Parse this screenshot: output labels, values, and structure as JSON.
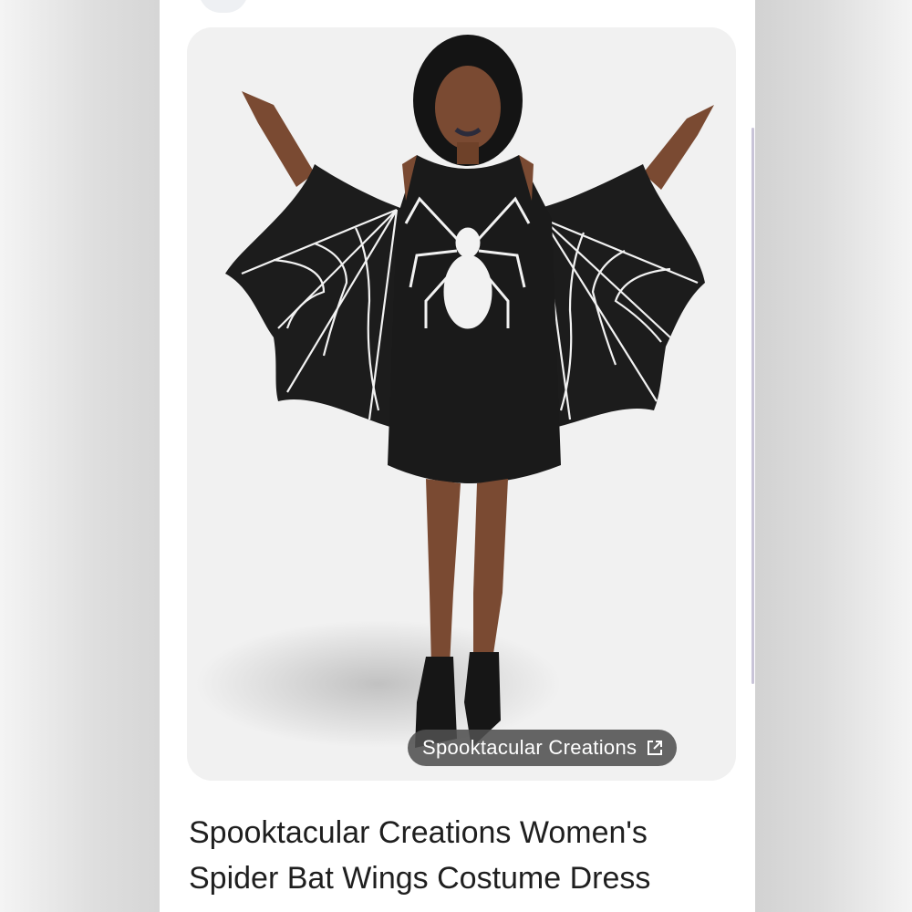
{
  "result": {
    "image": {
      "alt": "Woman wearing a black spider bat wings costume dress with white spider web print"
    },
    "source_chip": {
      "label": "Spooktacular Creations",
      "icon": "open-in-new-icon"
    },
    "title_line1": "Spooktacular Creations Women's",
    "title_line2": "Spider Bat Wings Costume Dress"
  },
  "colors": {
    "panel_bg": "#ffffff",
    "card_bg": "#f1f1f1",
    "chip_bg": "#505050",
    "title_text": "#1f1f1f",
    "garment": "#1c1c1c",
    "web_print": "#f2f2f2"
  }
}
